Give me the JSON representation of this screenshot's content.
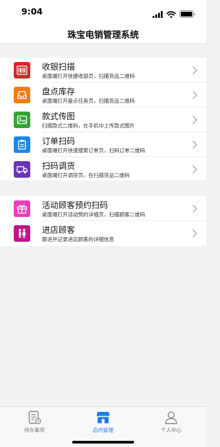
{
  "status_bar": {
    "time": "9:04",
    "icons": [
      "signal-icon",
      "wifi-icon",
      "battery-icon"
    ]
  },
  "nav": {
    "title": "珠宝电销管理系统"
  },
  "sections": [
    {
      "items": [
        {
          "title": "收银扫描",
          "subtitle": "桌面端打开快捷收银页，扫描货品二维码",
          "icon": "barcode-icon",
          "color": "#d9252a"
        },
        {
          "title": "盘点库存",
          "subtitle": "桌面端打开盘点任务页，扫描货品二维码",
          "icon": "inbox-icon",
          "color": "#ef7d14"
        },
        {
          "title": "款式传图",
          "subtitle": "扫描款式二维码，在手机中上传款式图片",
          "icon": "image-icon",
          "color": "#2fa52f"
        },
        {
          "title": "订单扫码",
          "subtitle": "桌面端打开快速搜索订单页，扫码订单二维码",
          "icon": "clipboard-icon",
          "color": "#1e88e5"
        },
        {
          "title": "扫码调货",
          "subtitle": "桌面端打开调货页，在扫描货品二维码",
          "icon": "truck-icon",
          "color": "#6a35b5"
        }
      ]
    },
    {
      "items": [
        {
          "title": "活动顾客预约扫码",
          "subtitle": "桌面端打开活动预约详细页，扫描顾客二维码",
          "icon": "gift-icon",
          "color": "#e83fb8"
        },
        {
          "title": "进店顾客",
          "subtitle": "跟进并记录进店顾客的详细信息",
          "icon": "people-icon",
          "color": "#c1148a"
        }
      ]
    }
  ],
  "tab_bar": {
    "tabs": [
      {
        "label": "待办事项",
        "icon": "todo-list-icon",
        "active": false
      },
      {
        "label": "店内管理",
        "icon": "store-icon",
        "active": true
      },
      {
        "label": "个人中心",
        "icon": "person-icon",
        "active": false
      }
    ],
    "active_color": "#1a7fe6",
    "inactive_color": "#777777"
  }
}
